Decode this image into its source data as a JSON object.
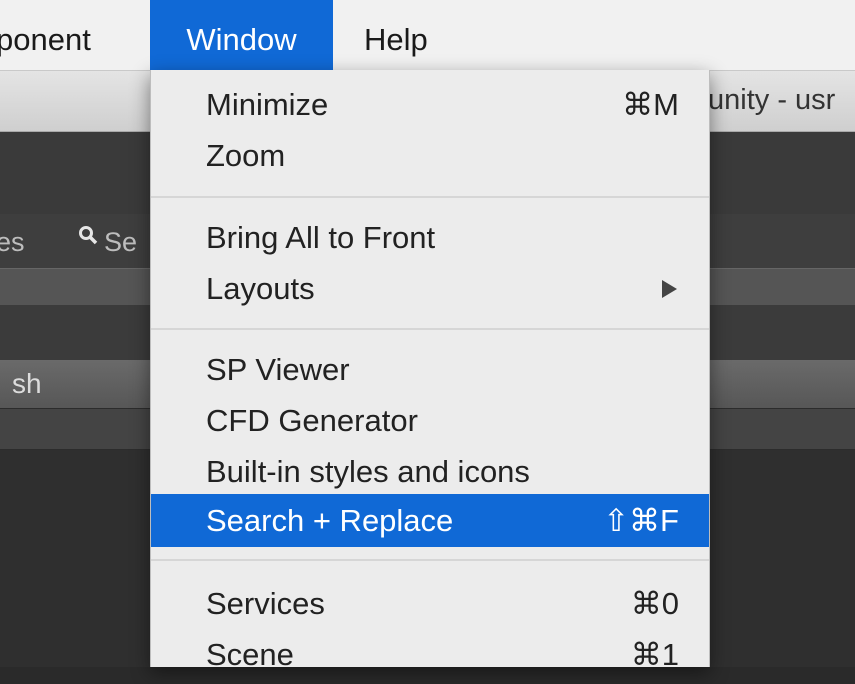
{
  "menubar": {
    "items": [
      {
        "label": "ponent"
      },
      {
        "label": "Window"
      },
      {
        "label": "Help"
      }
    ]
  },
  "background": {
    "window_title": "unity - usr",
    "tabs": [
      {
        "label": "es"
      },
      {
        "label": "Se"
      }
    ],
    "search_text": "sh"
  },
  "window_menu": {
    "groups": [
      {
        "items": [
          {
            "label": "Minimize",
            "shortcut": "⌘M"
          },
          {
            "label": "Zoom",
            "shortcut": ""
          }
        ]
      },
      {
        "items": [
          {
            "label": "Bring All to Front",
            "shortcut": ""
          },
          {
            "label": "Layouts",
            "submenu": true
          }
        ]
      },
      {
        "items": [
          {
            "label": "SP Viewer",
            "shortcut": ""
          },
          {
            "label": "CFD Generator",
            "shortcut": ""
          },
          {
            "label": "Built-in styles and icons",
            "shortcut": ""
          },
          {
            "label": "Search + Replace",
            "shortcut": "⇧⌘F",
            "highlighted": true
          }
        ]
      },
      {
        "items": [
          {
            "label": "Services",
            "shortcut": "⌘0"
          },
          {
            "label": "Scene",
            "shortcut": "⌘1"
          }
        ]
      }
    ]
  },
  "colors": {
    "accent": "#1069d6",
    "menu_bg": "#ececec"
  }
}
